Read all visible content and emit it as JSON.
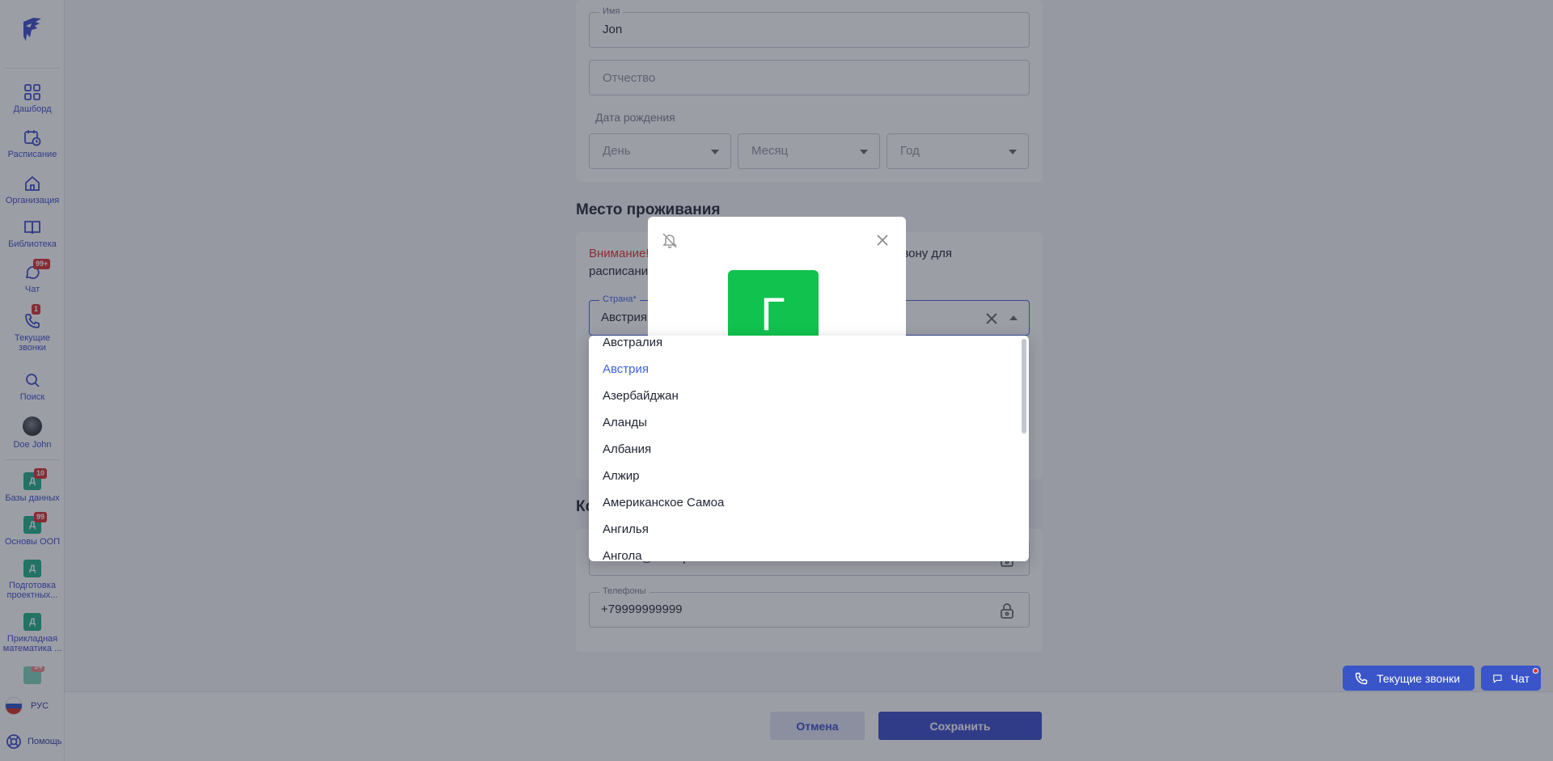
{
  "sidebar": {
    "items": [
      {
        "label": "Дашборд",
        "icon": "dashboard-icon"
      },
      {
        "label": "Расписание",
        "icon": "calendar-icon"
      },
      {
        "label": "Организация",
        "icon": "home-icon"
      },
      {
        "label": "Библиотека",
        "icon": "book-icon"
      },
      {
        "label": "Чат",
        "icon": "chat-icon",
        "badge": "99+"
      },
      {
        "label": "Текущие звонки",
        "icon": "phone-icon",
        "badge": "1"
      },
      {
        "label": "Поиск",
        "icon": "search-icon"
      },
      {
        "label": "Doe John",
        "icon": "avatar"
      }
    ],
    "courses": [
      {
        "label": "Базы данных",
        "letter": "Д",
        "badge": "10"
      },
      {
        "label": "Основы ООП",
        "letter": "Д",
        "badge": "99"
      },
      {
        "label": "Подготовка проектных...",
        "letter": "Д"
      },
      {
        "label": "Прикладная математика ...",
        "letter": "Д"
      },
      {
        "badge": "14"
      }
    ],
    "language": "РУС",
    "help": "Помощь"
  },
  "form": {
    "first_name": {
      "label": "Имя",
      "value": "Jon"
    },
    "patronymic": {
      "placeholder": "Отчество"
    },
    "birth_date": {
      "label": "Дата рождения",
      "day": "День",
      "month": "Месяц",
      "year": "Год"
    },
    "residence": {
      "title": "Место проживания",
      "warning_bold": "Внимание!",
      "warning_right": "ю зону для",
      "warning_line2": "расписани",
      "country": {
        "label": "Страна*",
        "value": "Австрия"
      }
    },
    "contacts": {
      "title_fragment": "Ко",
      "email_value": "student@example.com",
      "phones_label": "Телефоны",
      "phone_value": "+79999999999"
    }
  },
  "country_dropdown": {
    "options": [
      "Австралия",
      "Австрия",
      "Азербайджан",
      "Аланды",
      "Албания",
      "Алжир",
      "Американское Самоа",
      "Ангилья",
      "Ангола"
    ],
    "selected": "Австрия"
  },
  "modal": {
    "avatar_letter": "Г",
    "avatar_color": "#11c24f"
  },
  "floating": {
    "calls_label": "Текущие звонки",
    "chat_label": "Чат"
  },
  "footer": {
    "cancel": "Отмена",
    "save": "Сохранить"
  },
  "colors": {
    "accent": "#3a4bc7",
    "warning": "#d8332c",
    "badge": "#d92b2b",
    "course": "#1fae8a"
  }
}
